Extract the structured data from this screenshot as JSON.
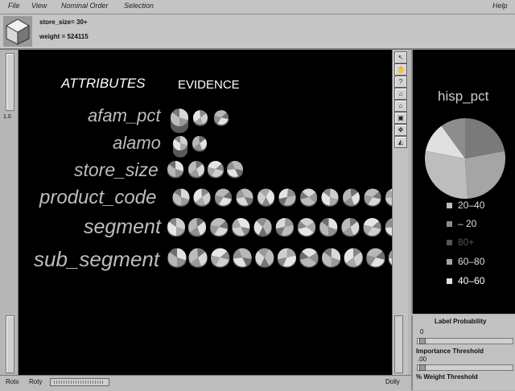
{
  "menu": {
    "file": "File",
    "view": "View",
    "nominal_order": "Nominal Order",
    "selection": "Selection",
    "help": "Help"
  },
  "info": {
    "line1": "store_size= 30+",
    "line2": "weight = 524115"
  },
  "left_slider": {
    "label": "1.0"
  },
  "viewer": {
    "attributes_header": "ATTRIBUTES",
    "evidence_header": "EVIDENCE",
    "rows": [
      {
        "label": "afam_pct",
        "pies": 3
      },
      {
        "label": "alamo",
        "pies": 2
      },
      {
        "label": "store_size",
        "pies": 4
      },
      {
        "label": "product_code",
        "pies": 11
      },
      {
        "label": "segment",
        "pies": 11
      },
      {
        "label": "sub_segment",
        "pies": 11
      }
    ]
  },
  "tools": [
    "arrow-icon",
    "hand-icon",
    "help-icon",
    "home-icon",
    "set-home-icon",
    "view-all-icon",
    "seek-icon",
    "perspective-icon"
  ],
  "tool_glyphs": [
    "↖",
    "✋",
    "?",
    "⌂",
    "⌂",
    "▣",
    "✥",
    "◭"
  ],
  "right_panel": {
    "title": "hisp_pct",
    "legend": [
      {
        "label": "20–40",
        "color": "#bdbdbd"
      },
      {
        "label": "– 20",
        "color": "#8d8d8d"
      },
      {
        "label": "80+",
        "color": "#555555"
      },
      {
        "label": "60–80",
        "color": "#a5a5a5"
      },
      {
        "label": "40–60",
        "color": "#e0e0e0"
      }
    ],
    "pie_slices": [
      {
        "name": "20-40",
        "fraction": 0.22,
        "color": "#7a7a7a"
      },
      {
        "name": "-20",
        "fraction": 0.27,
        "color": "#a5a5a5"
      },
      {
        "name": "80+",
        "fraction": 0.29,
        "color": "#bdbdbd"
      },
      {
        "name": "60-80",
        "fraction": 0.12,
        "color": "#e0e0e0"
      },
      {
        "name": "40-60",
        "fraction": 0.1,
        "color": "#8d8d8d"
      }
    ]
  },
  "controls": {
    "label_probability": "Label Probability",
    "label_probability_value": "0",
    "importance_threshold": "Importance Threshold",
    "importance_threshold_value": ".00",
    "weight_threshold": "% Weight Threshold"
  },
  "bottom": {
    "rotx": "Rotx",
    "roty": "Roty",
    "dolly": "Dolly"
  }
}
